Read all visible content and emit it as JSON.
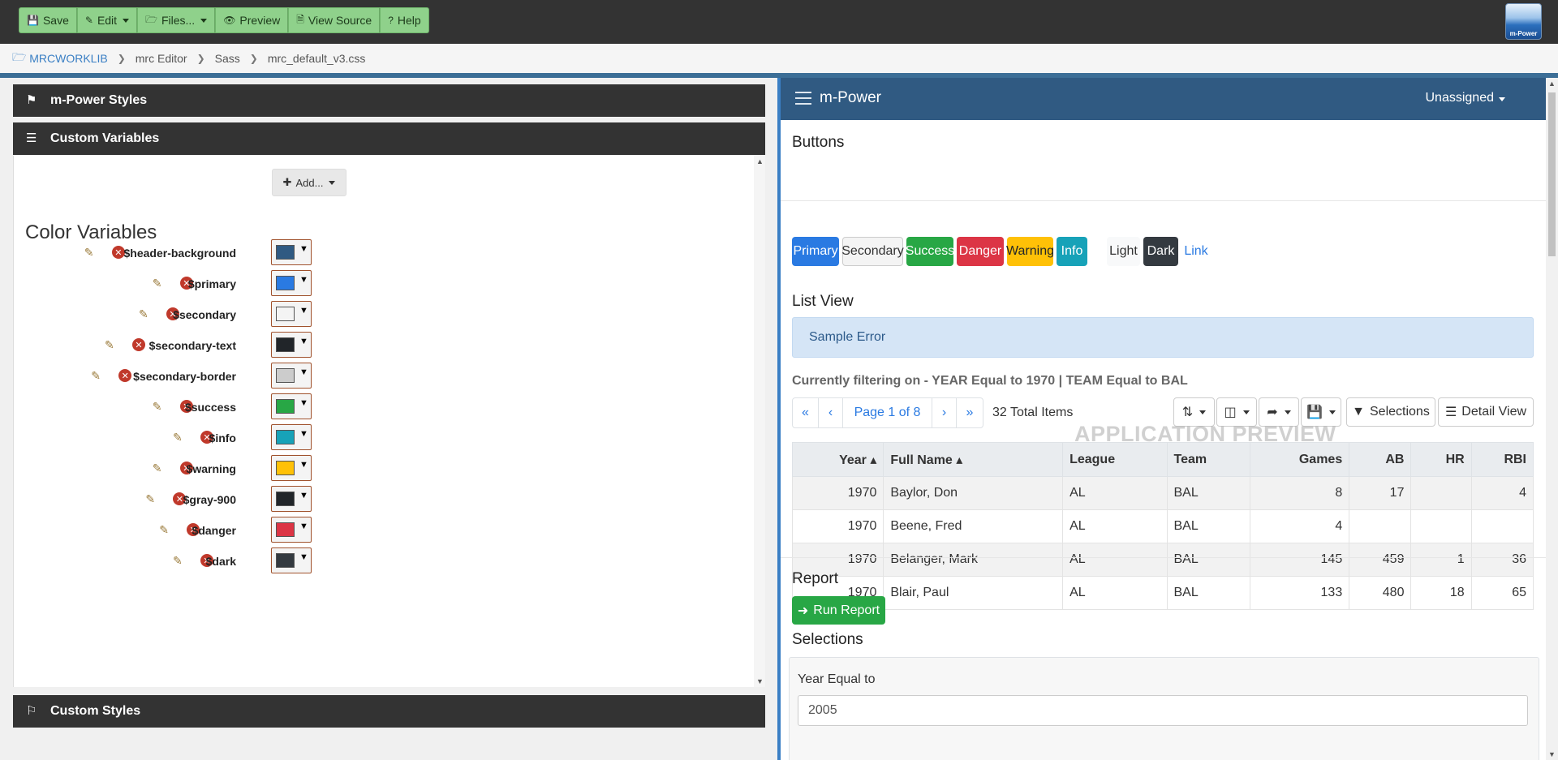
{
  "toolbar": {
    "save": "Save",
    "edit": "Edit",
    "files": "Files...",
    "preview": "Preview",
    "view_source": "View Source",
    "help": "Help",
    "logo_text": "m-Power"
  },
  "breadcrumb": [
    "MRCWORKLIB",
    "mrc Editor",
    "Sass",
    "mrc_default_v3.css"
  ],
  "left": {
    "section1": "m-Power Styles",
    "section2": "Custom Variables",
    "section3": "Custom Styles",
    "add_label": "Add...",
    "color_title": "Color Variables",
    "variables": [
      {
        "name": "$header-background",
        "color": "#305a82"
      },
      {
        "name": "$primary",
        "color": "#2a7ae2"
      },
      {
        "name": "$secondary",
        "color": "#f4f4f4"
      },
      {
        "name": "$secondary-text",
        "color": "#212529"
      },
      {
        "name": "$secondary-border",
        "color": "#cccccc"
      },
      {
        "name": "$success",
        "color": "#28a745"
      },
      {
        "name": "$info",
        "color": "#17a2b8"
      },
      {
        "name": "$warning",
        "color": "#ffc107"
      },
      {
        "name": "$gray-900",
        "color": "#212529"
      },
      {
        "name": "$danger",
        "color": "#dc3545"
      },
      {
        "name": "$dark",
        "color": "#343a40"
      }
    ]
  },
  "preview": {
    "brand": "m-Power",
    "user": "Unassigned",
    "buttons_title": "Buttons",
    "buttons": [
      {
        "label": "Primary",
        "bg": "#2a7ae2",
        "fg": "#ffffff"
      },
      {
        "label": "Secondary",
        "bg": "#f4f4f4",
        "fg": "#333333"
      },
      {
        "label": "Success",
        "bg": "#28a745",
        "fg": "#ffffff"
      },
      {
        "label": "Danger",
        "bg": "#dc3545",
        "fg": "#ffffff"
      },
      {
        "label": "Warning",
        "bg": "#ffc107",
        "fg": "#212529"
      },
      {
        "label": "Info",
        "bg": "#17a2b8",
        "fg": "#ffffff"
      },
      {
        "label": "Light",
        "bg": "#f8f9fa",
        "fg": "#333333"
      },
      {
        "label": "Dark",
        "bg": "#343a40",
        "fg": "#ffffff"
      },
      {
        "label": "Link",
        "bg": "#ffffff",
        "fg": "#2a7ae2"
      }
    ],
    "list_title": "List View",
    "error": "Sample Error",
    "filter": "Currently filtering on - YEAR Equal to 1970 | TEAM Equal to BAL",
    "page_label": "Page 1 of 8",
    "total": "32 Total Items",
    "selections_btn": "Selections",
    "detail_btn": "Detail View",
    "columns": [
      "Year",
      "Full Name",
      "League",
      "Team",
      "Games",
      "AB",
      "HR",
      "RBI"
    ],
    "rows": [
      [
        "1970",
        "Baylor, Don",
        "AL",
        "BAL",
        "8",
        "17",
        "",
        "4"
      ],
      [
        "1970",
        "Beene, Fred",
        "AL",
        "BAL",
        "4",
        "",
        "",
        ""
      ],
      [
        "1970",
        "Belanger, Mark",
        "AL",
        "BAL",
        "145",
        "459",
        "1",
        "36"
      ],
      [
        "1970",
        "Blair, Paul",
        "AL",
        "BAL",
        "133",
        "480",
        "18",
        "65"
      ]
    ],
    "watermark": "APPLICATION PREVIEW",
    "report_title": "Report",
    "run_report": "Run Report",
    "selections_title": "Selections",
    "sel_label": "Year Equal to",
    "sel_value": "2005"
  }
}
